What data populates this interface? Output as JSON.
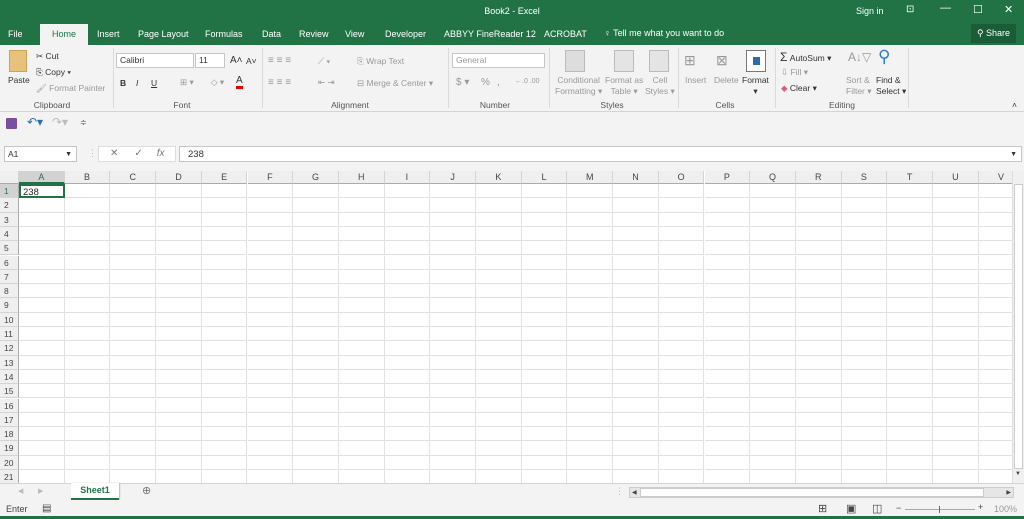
{
  "window": {
    "title": "Book2  -  Excel",
    "sign_in": "Sign in",
    "share": "Share"
  },
  "colors": {
    "brand": "#217346",
    "font_color_bar": "#e00000"
  },
  "tabs": [
    "File",
    "Home",
    "Insert",
    "Page Layout",
    "Formulas",
    "Data",
    "Review",
    "View",
    "Developer",
    "ABBYY FineReader 12",
    "ACROBAT"
  ],
  "tell_me": "Tell me what you want to do",
  "ribbon": {
    "clipboard": {
      "paste": "Paste",
      "cut": "Cut",
      "copy": "Copy",
      "format_painter": "Format Painter",
      "label": "Clipboard"
    },
    "font": {
      "name": "Calibri",
      "size": "11",
      "bold": "B",
      "italic": "I",
      "underline": "U",
      "label": "Font",
      "color_letter": "A"
    },
    "alignment": {
      "wrap": "Wrap Text",
      "merge": "Merge & Center",
      "label": "Alignment"
    },
    "number": {
      "format": "General",
      "currency": "$",
      "percent": "%",
      "comma": ",",
      "label": "Number"
    },
    "styles": {
      "cond1": "Conditional",
      "cond2": "Formatting",
      "fmt1": "Format as",
      "fmt2": "Table",
      "cell1": "Cell",
      "cell2": "Styles",
      "label": "Styles"
    },
    "cells": {
      "insert": "Insert",
      "delete": "Delete",
      "format": "Format",
      "label": "Cells"
    },
    "editing": {
      "autosum": "AutoSum",
      "fill": "Fill",
      "clear": "Clear",
      "sort1": "Sort &",
      "sort2": "Filter",
      "find1": "Find &",
      "find2": "Select",
      "label": "Editing"
    }
  },
  "formula_bar": {
    "name_box": "A1",
    "value": "238",
    "fx": "fx"
  },
  "columns": [
    "A",
    "B",
    "C",
    "D",
    "E",
    "F",
    "G",
    "H",
    "I",
    "J",
    "K",
    "L",
    "M",
    "N",
    "O",
    "P",
    "Q",
    "R",
    "S",
    "T",
    "U",
    "V"
  ],
  "rows": 21,
  "cells": {
    "A1": "238"
  },
  "sheets": [
    "Sheet1"
  ],
  "status": {
    "mode": "Enter",
    "zoom": "100%"
  }
}
